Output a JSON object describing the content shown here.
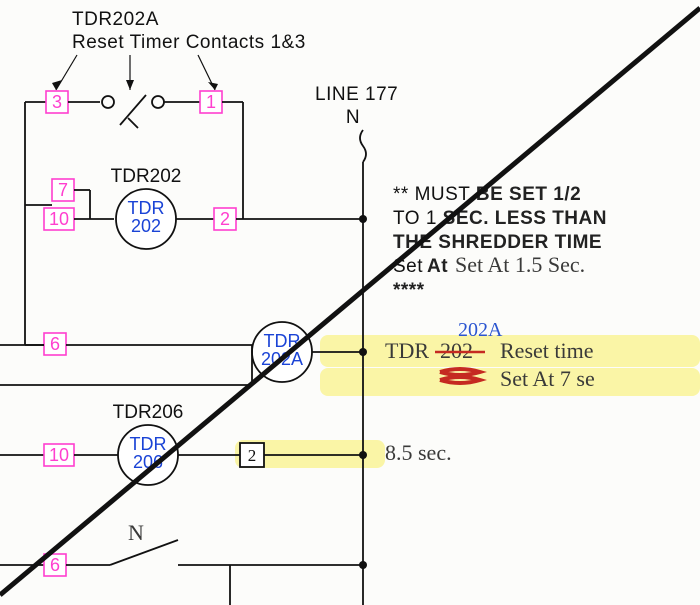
{
  "title": {
    "line1": "TDR202A",
    "line2": "Reset Timer Contacts 1&3"
  },
  "terminals": {
    "t3": "3",
    "t1": "1",
    "t7": "7",
    "t10a": "10",
    "t2": "2",
    "t6a": "6",
    "t10b": "10",
    "t2b": "2",
    "t6b": "6"
  },
  "coils": {
    "tdr202": {
      "top": "TDR",
      "bot": "202",
      "label": "TDR202"
    },
    "tdr202A": {
      "top": "TDR",
      "bot": "202A",
      "label": "TDR202A"
    },
    "tdr206": {
      "top": "TDR",
      "bot": "206",
      "label": "TDR206"
    }
  },
  "line177": {
    "label": "LINE 177",
    "sub": "N"
  },
  "note": {
    "star": "**",
    "l1a": "MUST ",
    "l1b": "BE SET 1/2",
    "l2a": "TO 1 ",
    "l2b": "SEC. LESS THAN",
    "l3": "THE SHREDDER TIME",
    "l4a": "Set",
    "l4b": "At",
    "l5": "****"
  },
  "handwriting": {
    "set_at_15": "Set At 1.5 Sec.",
    "tdr_prefix": "TDR",
    "num_202A": "202A",
    "num_202_strike": "202",
    "reset_time": "Reset time",
    "scribble": "———",
    "set_at_7": "Set At  7 se",
    "eight5": "8.5 sec.",
    "n_label": "N"
  }
}
